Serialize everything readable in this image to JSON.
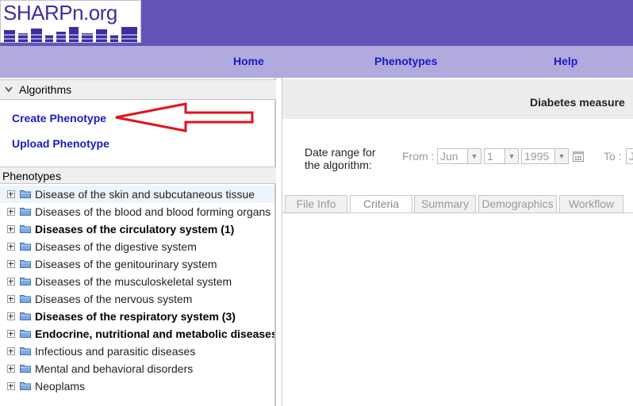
{
  "header": {
    "logo_text": "SHARPn.org"
  },
  "nav": {
    "home": "Home",
    "phenotypes": "Phenotypes",
    "help": "Help"
  },
  "algorithms": {
    "title": "Algorithms",
    "create_label": "Create Phenotype",
    "upload_label": "Upload Phenotype"
  },
  "phenotypes": {
    "title": "Phenotypes",
    "items": [
      {
        "label": "Disease of the skin and subcutaneous tissue",
        "bold": false
      },
      {
        "label": "Diseases of the blood and blood forming organs",
        "bold": false
      },
      {
        "label": "Diseases of the circulatory system (1)",
        "bold": true
      },
      {
        "label": "Diseases of the digestive system",
        "bold": false
      },
      {
        "label": "Diseases of the genitourinary system",
        "bold": false
      },
      {
        "label": "Diseases of the musculoskeletal system",
        "bold": false
      },
      {
        "label": "Diseases of the nervous system",
        "bold": false
      },
      {
        "label": "Diseases of the respiratory system (3)",
        "bold": true
      },
      {
        "label": "Endocrine, nutritional and metabolic diseases",
        "bold": true
      },
      {
        "label": "Infectious and parasitic diseases",
        "bold": false
      },
      {
        "label": "Mental and behavioral disorders",
        "bold": false
      },
      {
        "label": "Neoplams",
        "bold": false
      }
    ]
  },
  "main": {
    "title": "Diabetes measure",
    "date_range_line1": "Date range for",
    "date_range_line2": "the algorithm:",
    "from_label": "From :",
    "from_month": "Jun",
    "from_day": "1",
    "from_year": "1995",
    "to_label": "To :",
    "to_month": "J",
    "tabs": [
      "File Info",
      "Criteria",
      "Summary",
      "Demographics",
      "Workflow"
    ],
    "active_tab": "Criteria"
  },
  "annotation": {
    "arrow_color": "#e0141c"
  }
}
